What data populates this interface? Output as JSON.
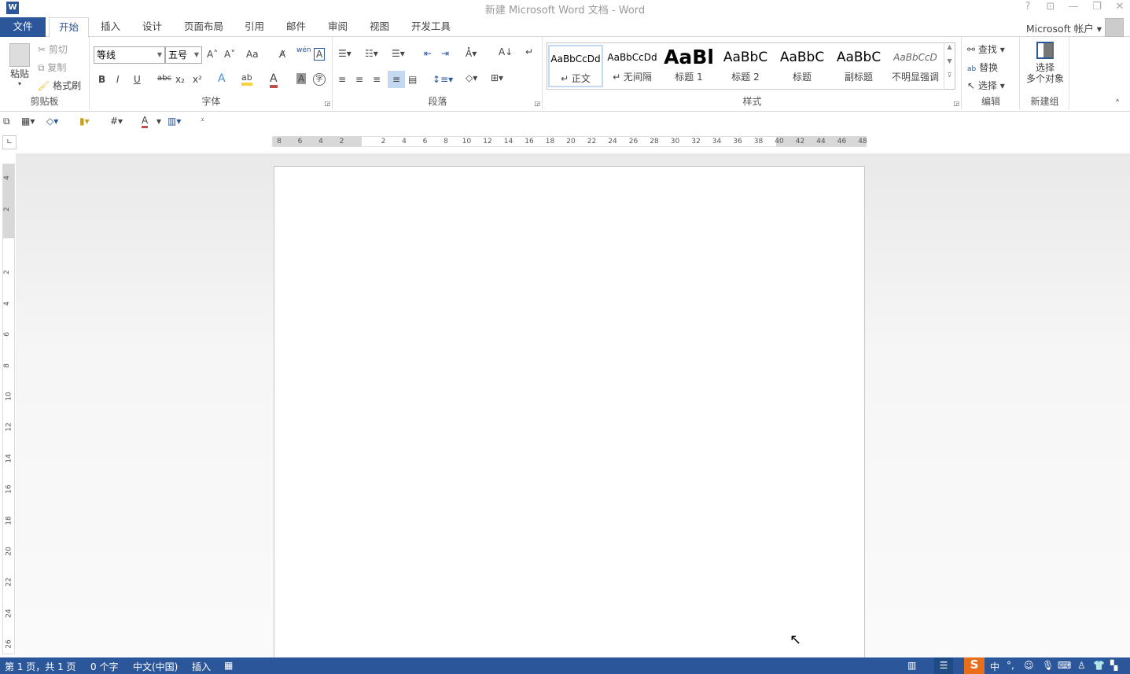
{
  "window": {
    "title": "新建 Microsoft Word 文档 - Word",
    "help": "?",
    "ribbon_options": "⊡",
    "minimize": "—",
    "restore": "❐",
    "close": "✕",
    "app_icon": "word-icon"
  },
  "tabs": [
    {
      "label": "文件"
    },
    {
      "label": "开始"
    },
    {
      "label": "插入"
    },
    {
      "label": "设计"
    },
    {
      "label": "页面布局"
    },
    {
      "label": "引用"
    },
    {
      "label": "邮件"
    },
    {
      "label": "审阅"
    },
    {
      "label": "视图"
    },
    {
      "label": "开发工具"
    }
  ],
  "account": {
    "label": "Microsoft 帐户"
  },
  "clipboard": {
    "paste": "粘贴",
    "cut": "剪切",
    "copy": "复制",
    "format_painter": "格式刷",
    "label": "剪贴板"
  },
  "font": {
    "name": "等线",
    "size": "五号",
    "label": "字体",
    "bold": "B",
    "italic": "I",
    "underline": "U",
    "strike": "abc",
    "sub": "x₂",
    "sup": "x²",
    "grow": "A˄",
    "shrink": "A˅",
    "case": "Aa",
    "clear": "A̸",
    "phonetic": "wén",
    "border_char": "A",
    "effects": "A",
    "highlight": "ab",
    "color": "A",
    "shading": "A",
    "enclose": "字",
    "highlight_color": "#f5d33c",
    "font_color": "#c0504d"
  },
  "paragraph": {
    "label": "段落"
  },
  "styles": {
    "label": "样式",
    "items": [
      {
        "preview": "AaBbCcDd",
        "name": "↵ 正文"
      },
      {
        "preview": "AaBbCcDd",
        "name": "↵ 无间隔"
      },
      {
        "preview": "AaBl",
        "name": "标题 1"
      },
      {
        "preview": "AaBbC",
        "name": "标题 2"
      },
      {
        "preview": "AaBbC",
        "name": "标题"
      },
      {
        "preview": "AaBbC",
        "name": "副标题"
      },
      {
        "preview": "AaBbCcD",
        "name": "不明显强调"
      }
    ]
  },
  "editing": {
    "find": "查找",
    "replace": "替换",
    "select": "选择",
    "label": "编辑"
  },
  "newgroup": {
    "select_line1": "选择",
    "select_line2": "多个对象",
    "label": "新建组"
  },
  "ruler": {
    "h": [
      "8",
      "6",
      "4",
      "2",
      "2",
      "4",
      "6",
      "8",
      "10",
      "12",
      "14",
      "16",
      "18",
      "20",
      "22",
      "24",
      "26",
      "28",
      "30",
      "32",
      "34",
      "36",
      "38",
      "40",
      "42",
      "44",
      "46",
      "48"
    ],
    "v": [
      "4",
      "2",
      "2",
      "4",
      "6",
      "8",
      "10",
      "12",
      "14",
      "16",
      "18",
      "20",
      "22",
      "24",
      "26"
    ]
  },
  "status": {
    "page": "第 1 页，共 1 页",
    "words": "0 个字",
    "language": "中文(中国)",
    "mode": "插入",
    "ime": "中",
    "punct": "°,"
  },
  "colors": {
    "accent": "#2b579a"
  }
}
